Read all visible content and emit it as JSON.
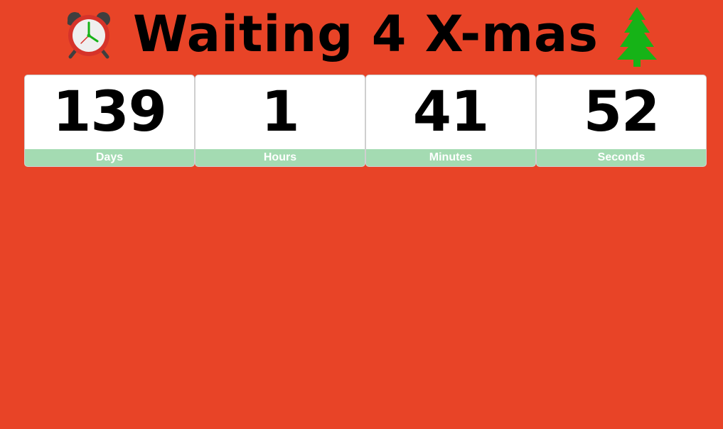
{
  "header": {
    "title": "Waiting 4 X-mas",
    "left_icon": "alarm-clock-icon",
    "right_icon": "christmas-tree-icon"
  },
  "countdown": [
    {
      "value": "139",
      "label": "Days"
    },
    {
      "value": "1",
      "label": "Hours"
    },
    {
      "value": "41",
      "label": "Minutes"
    },
    {
      "value": "52",
      "label": "Seconds"
    }
  ],
  "colors": {
    "background": "#e84427",
    "card_background": "#ffffff",
    "label_background": "#a4dbb2",
    "tree": "#16b317",
    "clock_ring": "#d6332a"
  }
}
